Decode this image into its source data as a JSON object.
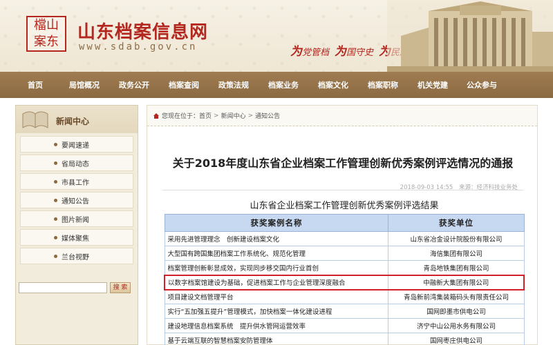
{
  "header": {
    "seal_text": "檔山\n案东",
    "site_name": "山东档案信息网",
    "site_url": "www.sdab.gov.cn",
    "slogan": [
      {
        "big": "为",
        "small": "党管档"
      },
      {
        "big": "为",
        "small": "国守史"
      },
      {
        "big": "为",
        "small": "民服务"
      }
    ]
  },
  "nav": {
    "items": [
      "首页",
      "局馆概况",
      "政务公开",
      "档案查阅",
      "政策法规",
      "档案业务",
      "档案文化",
      "档案职称",
      "机关党建",
      "公众参与"
    ]
  },
  "sidebar": {
    "title": "新闻中心",
    "items": [
      "要闻速递",
      "省局动态",
      "市县工作",
      "通知公告",
      "图片新闻",
      "媒体聚焦",
      "兰台视野"
    ],
    "search_value": "",
    "search_button": "搜 索"
  },
  "breadcrumb": {
    "prefix": "您现在位于：",
    "items": [
      "首页",
      "新闻中心",
      "通知公告"
    ],
    "separator": ">"
  },
  "article": {
    "title": "关于2018年度山东省企业档案工作管理创新优秀案例评选情况的通报",
    "date": "2018-09-03 14:55",
    "source": "来源：经济科技业务处"
  },
  "case_table": {
    "caption": "山东省企业档案工作管理创新优秀案例评选结果",
    "headers": [
      "获奖案例名称",
      "获奖单位"
    ],
    "rows": [
      {
        "name": "采用先进管理理念　创新建设档案文化",
        "unit": "山东省冶金设计院股份有限公司"
      },
      {
        "name": "大型国有跨国集团档案工作系统化、规范化管理",
        "unit": "海信集团有限公司"
      },
      {
        "name": "档案管理创新彰显成效，实现同步移交国内行业首创",
        "unit": "青岛地铁集团有限公司"
      },
      {
        "name": "以数字档案馆建设为基础，促进档案工作与企业管理深度融合",
        "unit": "中融新大集团有限公司"
      },
      {
        "name": "项目建设文档管理平台",
        "unit": "青岛新前湾集装箱码头有限责任公司"
      },
      {
        "name": "实行“五加强五提升”管理模式，加快档案一体化建设进程",
        "unit": "国网即墨市供电公司"
      },
      {
        "name": "建设地理信息档案系统　提升供水管网运营效率",
        "unit": "济宁中山公用水务有限公司"
      },
      {
        "name": "基于云端互联的智慧档案安防管理体",
        "unit": "国网枣庄供电公司"
      }
    ],
    "highlighted_row": 3
  },
  "colors": {
    "brand_red": "#b3271f",
    "nav_brown": "#8b6a42",
    "table_header": "#c7d9f0",
    "highlight_border": "#d0202a"
  }
}
